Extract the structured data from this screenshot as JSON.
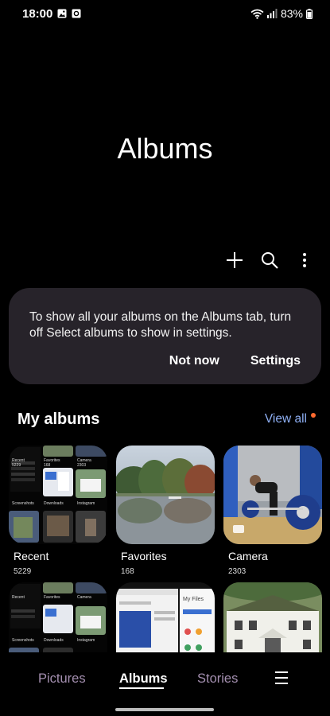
{
  "status": {
    "time": "18:00",
    "battery": "83%"
  },
  "header": {
    "title": "Albums"
  },
  "toolbar": {
    "icons": [
      "plus-icon",
      "search-icon",
      "more-vert-icon"
    ]
  },
  "notice": {
    "message": "To show all your albums on the Albums tab, turn off Select albums to show in settings.",
    "dismiss_label": "Not now",
    "settings_label": "Settings"
  },
  "my_albums": {
    "title": "My albums",
    "view_all": "View all",
    "albums": [
      {
        "name": "Recent",
        "count": "5229"
      },
      {
        "name": "Favorites",
        "count": "168"
      },
      {
        "name": "Camera",
        "count": "2303"
      }
    ],
    "mini_labels": {
      "recent": "Recent",
      "recent_count": "5229",
      "favorites": "Favorites",
      "favorites_count": "168",
      "camera": "Camera",
      "camera_count": "2303",
      "screenshots": "Screenshots",
      "downloads": "Downloads",
      "instagram": "Instagram",
      "my_files": "My Files"
    }
  },
  "bottom_nav": {
    "tabs": [
      "Pictures",
      "Albums",
      "Stories"
    ],
    "active": "Albums"
  },
  "colors": {
    "accent_link": "#8fb0f5",
    "notification_dot": "#ff6a2f",
    "inactive_tab": "#a48fb0",
    "card_bg": "#27232a"
  }
}
